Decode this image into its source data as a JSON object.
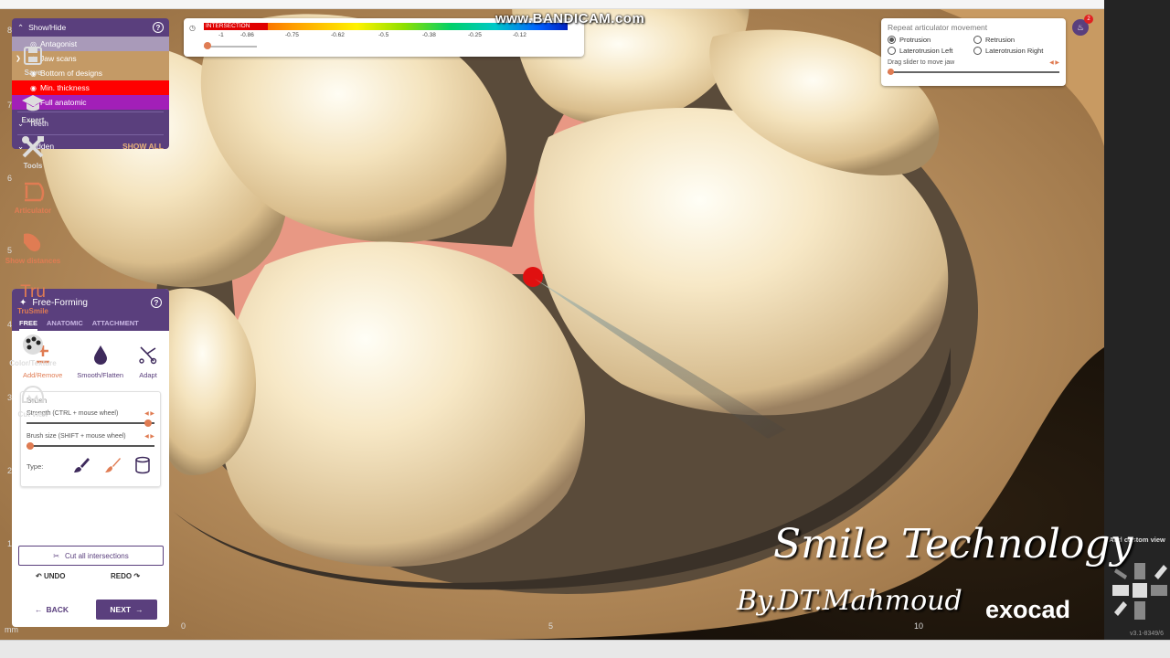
{
  "app": {
    "name": "exocad",
    "version": "v3.1-8349/6"
  },
  "recorder_watermark": "www.BANDICAM.com",
  "watermark": {
    "line1": "Smile Technology",
    "line2": "By.DT.Mahmoud",
    "brand": "exocad"
  },
  "ruler": {
    "left": [
      "8",
      "7",
      "6",
      "5",
      "4",
      "3",
      "2",
      "1",
      "mm"
    ],
    "bottom": [
      "0",
      "5",
      "10"
    ]
  },
  "show_hide": {
    "title": "Show/Hide",
    "items": [
      {
        "label": "Antagonist",
        "bg": "#a99ab9",
        "expand": false
      },
      {
        "label": "Jaw scans",
        "bg": "#c49a66",
        "expand": true
      },
      {
        "label": "Bottom of designs",
        "bg": "#c49a66",
        "expand": false
      },
      {
        "label": "Min. thickness",
        "bg": "#ff0000",
        "expand": false
      },
      {
        "label": "Full anatomic",
        "bg": "#a21fb8",
        "expand": false
      }
    ],
    "teeth": "Teeth",
    "hidden": "Hidden",
    "show_all": "SHOW ALL"
  },
  "free_forming": {
    "title": "Free-Forming",
    "tabs": [
      "FREE",
      "ANATOMIC",
      "ATTACHMENT"
    ],
    "active_tab": "FREE",
    "tools": [
      {
        "label": "Add/Remove",
        "icon": "plus-minus-icon",
        "active": true
      },
      {
        "label": "Smooth/Flatten",
        "icon": "drop-icon",
        "active": false
      },
      {
        "label": "Adapt",
        "icon": "adapt-icon",
        "active": false
      }
    ],
    "brush": {
      "title": "Brush",
      "strength": {
        "label": "Strength (CTRL + mouse wheel)",
        "value": 0.95
      },
      "size": {
        "label": "Brush size (SHIFT + mouse wheel)",
        "value": 0.03
      },
      "type_label": "Type:"
    },
    "cut_all": "Cut all intersections",
    "undo": "UNDO",
    "redo": "REDO",
    "back": "BACK",
    "next": "NEXT"
  },
  "legend": {
    "intersection": "INTERSECTION",
    "ticks": [
      "-1",
      "-0.86",
      "-0.75",
      "-0.62",
      "-0.5",
      "-0.38",
      "-0.25",
      "-0.12"
    ]
  },
  "articulator": {
    "title": "Repeat articulator movement",
    "options": [
      {
        "label": "Protrusion",
        "selected": true
      },
      {
        "label": "Retrusion",
        "selected": false
      },
      {
        "label": "Laterotrusion Left",
        "selected": false
      },
      {
        "label": "Laterotrusion Right",
        "selected": false
      }
    ],
    "drag_hint": "Drag slider to move jaw"
  },
  "notifications": {
    "count": "2"
  },
  "toolbar": {
    "buttons": [
      {
        "label": "Save",
        "icon": "save-icon",
        "accent": false
      },
      {
        "label": "Expert",
        "icon": "graduation-cap-icon",
        "accent": false
      },
      {
        "label": "Tools",
        "icon": "tools-icon",
        "accent": false
      },
      {
        "label": "Articulator",
        "icon": "articulator-icon",
        "accent": true
      },
      {
        "label": "Show distances",
        "icon": "distances-icon",
        "accent": true
      },
      {
        "label": "TruSmile",
        "icon": "trusmile-icon",
        "accent": true
      },
      {
        "label": "Color/Texture",
        "icon": "palette-icon",
        "accent": false
      },
      {
        "label": "Cut view",
        "icon": "cut-view-icon",
        "accent": false
      }
    ],
    "custom_view": "Add custom view"
  }
}
